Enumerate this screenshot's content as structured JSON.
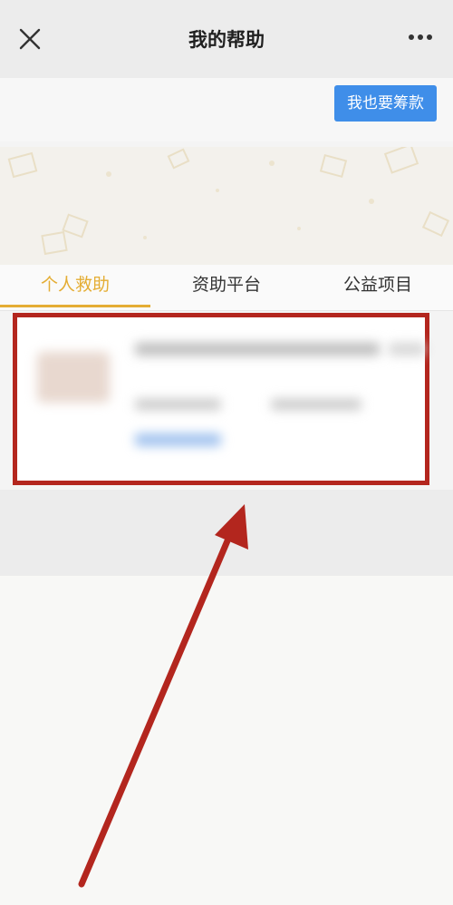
{
  "nav": {
    "title": "我的帮助",
    "close_icon": "close-icon",
    "more_icon": "more-dots-icon"
  },
  "action": {
    "raise_label": "我也要筹款"
  },
  "tabs": [
    {
      "label": "个人救助",
      "active": true
    },
    {
      "label": "资助平台",
      "active": false
    },
    {
      "label": "公益项目",
      "active": false
    }
  ],
  "colors": {
    "accent": "#e4ad34",
    "button": "#3f8ee9",
    "highlight": "#b3261e"
  },
  "annotation": {
    "arrow_icon": "arrow-icon"
  }
}
